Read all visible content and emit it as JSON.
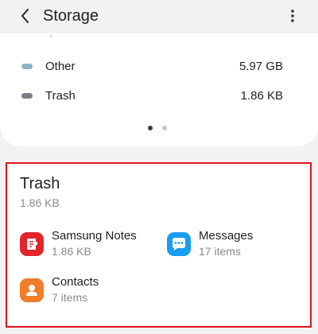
{
  "header": {
    "title": "Storage",
    "back_icon": "back-arrow-icon",
    "more_icon": "more-vertical-icon"
  },
  "storage_legend": {
    "items": [
      {
        "name": "Other",
        "size": "5.97 GB",
        "color": "#8fb2c7"
      },
      {
        "name": "Trash",
        "size": "1.86 KB",
        "color": "#7c7c86"
      }
    ],
    "pager": {
      "pages": 2,
      "active": 1,
      "active_color": "#3a3a3a",
      "inactive_color": "#c4c4c4"
    }
  },
  "trash": {
    "title": "Trash",
    "size": "1.86 KB",
    "highlight_color": "#e0141e",
    "apps": [
      {
        "name": "Samsung Notes",
        "detail": "1.86 KB",
        "icon": "samsung-notes-icon",
        "color": "#e2242b"
      },
      {
        "name": "Messages",
        "detail": "17 items",
        "icon": "messages-icon",
        "color": "#1a9cf0"
      },
      {
        "name": "Contacts",
        "detail": "7 items",
        "icon": "contacts-icon",
        "color": "#f07d2a"
      }
    ]
  }
}
